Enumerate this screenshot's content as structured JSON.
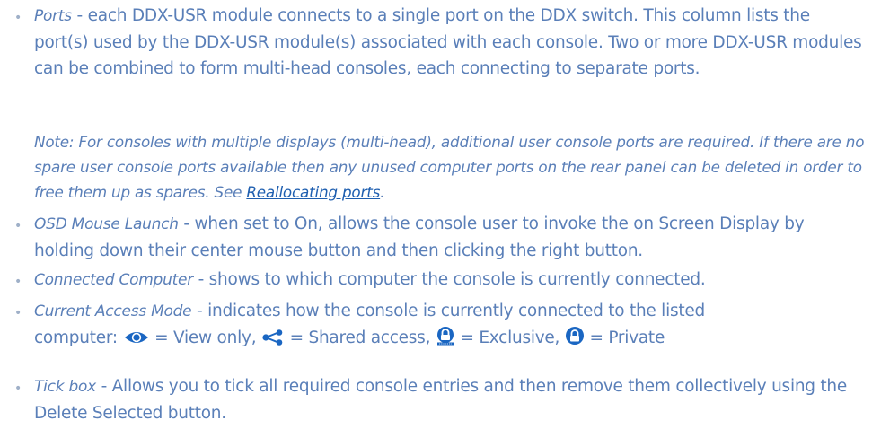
{
  "items": [
    {
      "term": "Ports",
      "text": " - each DDX-USR module connects to a single port on the DDX switch. This column lists the port(s) used by the DDX-USR module(s) associated with each console. Two or more DDX-USR modules can be combined to form multi-head consoles, each connecting to separate ports."
    },
    {
      "term": "OSD Mouse Launch",
      "text": " - when set to On, allows the console user to invoke the on Screen Display by holding down their center mouse button and then clicking the right button."
    },
    {
      "term": "Connected Computer",
      "text": " - shows to which computer the console is currently connected."
    },
    {
      "term": "Current Access Mode",
      "text_line1": " - indicates how the console is currently connected to the listed",
      "text_line2_prefix": "computer: ",
      "modes": {
        "view": " = View only, ",
        "shared": " = Shared access, ",
        "exclusive": " = Exclusive, ",
        "private": " = Private"
      }
    },
    {
      "term": "Tick box",
      "text": " - Allows you to tick all required console entries and then remove them collectively using the Delete Selected button."
    }
  ],
  "note": {
    "text": "Note: For consoles with multiple displays (multi-head), additional user console ports are required. If there are no spare user console ports available then any unused computer ports on the rear panel can be deleted in order to free them up as spares. See ",
    "link_text": "Reallocating ports",
    "suffix": "."
  },
  "bullet_char": "•",
  "colors": {
    "text": "#5a7fb8",
    "link": "#1f5fb0",
    "bullet": "#9fb0c8"
  },
  "icons": [
    "eye-icon",
    "share-icon",
    "padlock-keyboard-icon",
    "padlock-icon"
  ]
}
